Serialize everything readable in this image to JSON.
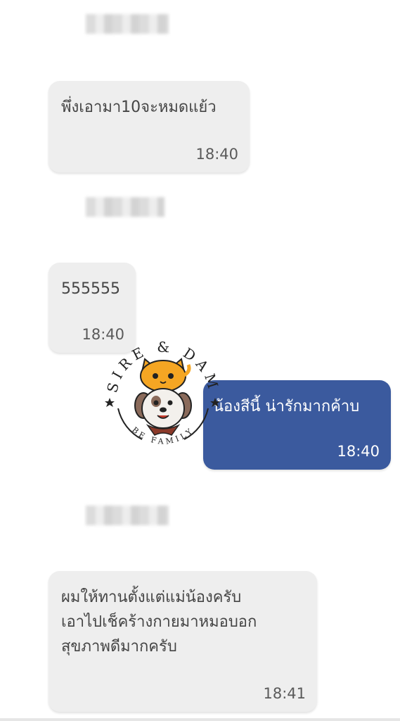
{
  "messages": [
    {
      "id": "m1",
      "direction": "incoming",
      "text": "พึ่งเอามา10จะหมดแย้ว",
      "time": "18:40"
    },
    {
      "id": "m2",
      "direction": "incoming",
      "text": "555555",
      "time": "18:40"
    },
    {
      "id": "m3",
      "direction": "outgoing",
      "text": "น้องสีนี้ น่ารักมากค้าบ",
      "time": "18:40"
    },
    {
      "id": "m4",
      "direction": "incoming",
      "text": "ผมให้ทานตั้งแต่แม่น้องครับ\nเอาไปเช็คร้างกายมาหมอบอก\nสุขภาพดีมากครับ",
      "time": "18:41"
    }
  ],
  "watermark": {
    "top_text": "SIRE & DAM",
    "bottom_text": "BE FAMILY"
  },
  "colors": {
    "incoming_bubble": "#eeeeee",
    "outgoing_bubble": "#3b5a9e",
    "cat_orange": "#f5a623"
  }
}
